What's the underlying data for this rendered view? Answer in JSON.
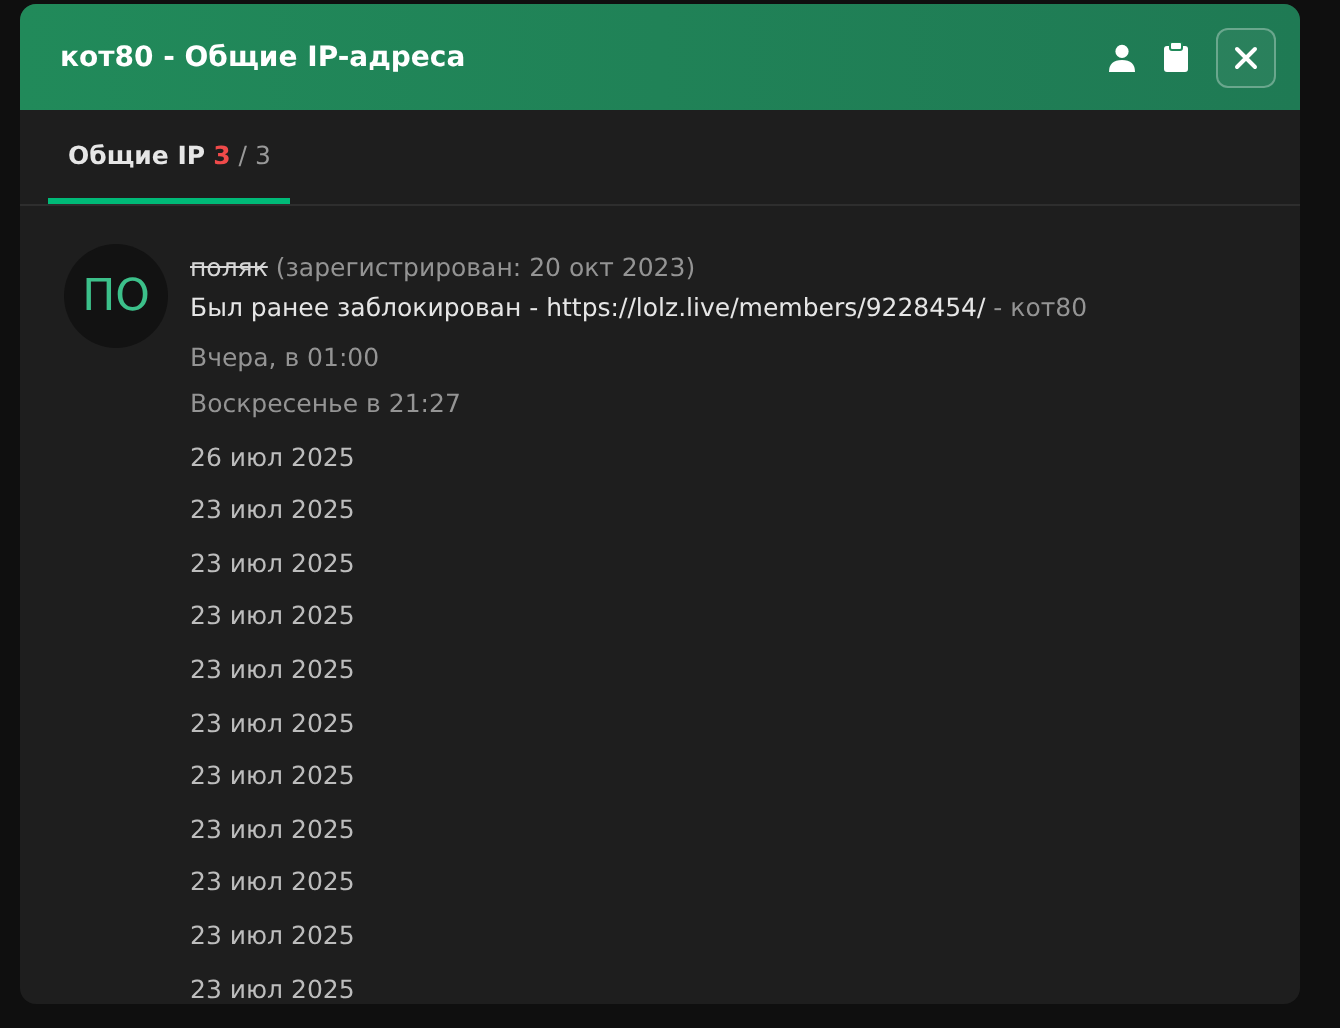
{
  "window": {
    "title": "кот80 - Общие IP-адреса"
  },
  "tabs": [
    {
      "label": "Общие IP",
      "count": "3",
      "total": "/ 3",
      "selected": true
    }
  ],
  "entries": [
    {
      "avatar": "ПО",
      "username": "поляк",
      "banned": true,
      "registered": "(зарегистрирован: 20 окт 2023)",
      "note": "Был ранее заблокирован - ",
      "link": "https://lolz.live/members/9228454/",
      "separator": " - ",
      "author": "кот80",
      "dates": [
        {
          "text": "Вчера, в 01:00",
          "kind": "muted"
        },
        {
          "text": "Воскресенье в 21:27",
          "kind": "muted"
        },
        {
          "text": "26 июл 2025",
          "kind": "plain"
        },
        {
          "text": "23 июл 2025",
          "kind": "plain"
        },
        {
          "text": "23 июл 2025",
          "kind": "plain"
        },
        {
          "text": "23 июл 2025",
          "kind": "plain"
        },
        {
          "text": "23 июл 2025",
          "kind": "plain"
        },
        {
          "text": "23 июл 2025",
          "kind": "plain"
        },
        {
          "text": "23 июл 2025",
          "kind": "plain"
        },
        {
          "text": "23 июл 2025",
          "kind": "plain"
        },
        {
          "text": "23 июл 2025",
          "kind": "plain"
        },
        {
          "text": "23 июл 2025",
          "kind": "plain"
        },
        {
          "text": "23 июл 2025",
          "kind": "plain"
        }
      ]
    }
  ]
}
